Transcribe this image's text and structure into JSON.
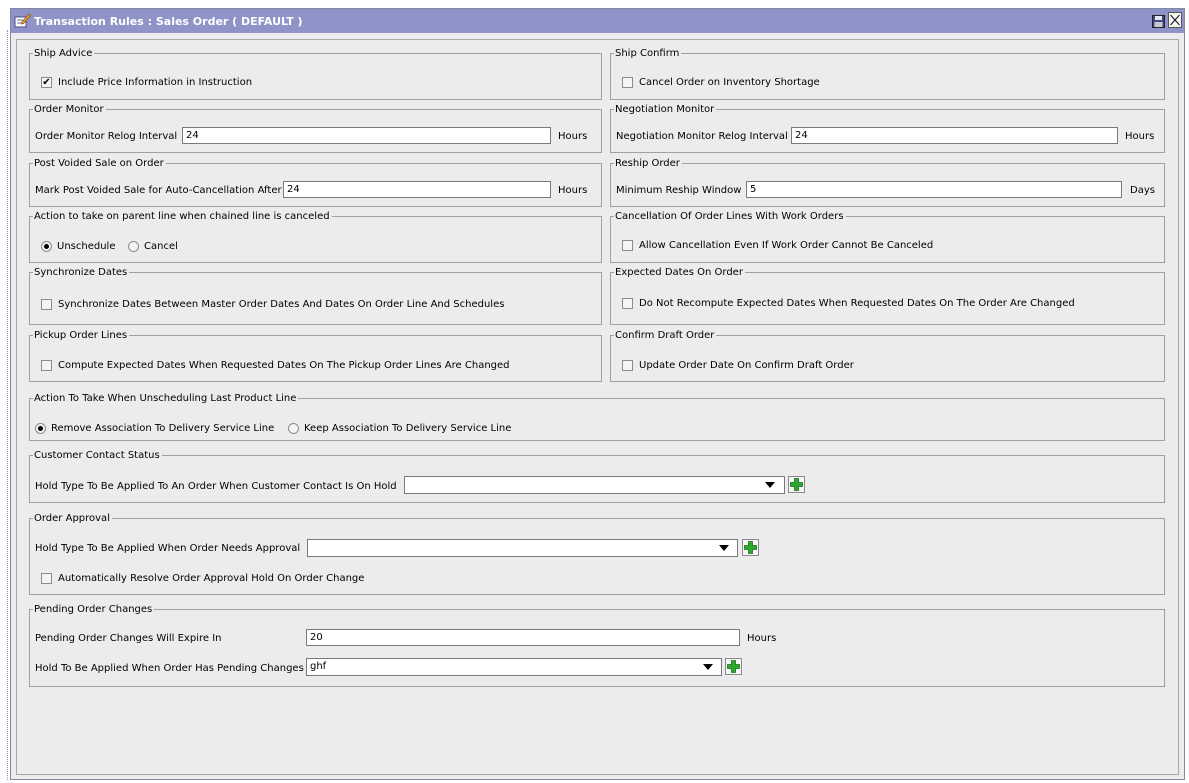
{
  "window": {
    "title": "Transaction Rules : Sales Order ( DEFAULT )",
    "title_icon": "edit-document-icon",
    "save_icon": "save-icon",
    "close_icon": "close-icon"
  },
  "colors": {
    "titlebar": "#8f93c8",
    "panel": "#ececec",
    "add_button": "#2fa82f"
  },
  "ship_advice": {
    "title": "Ship Advice",
    "include_price_label": "Include Price Information in Instruction",
    "include_price_checked": true
  },
  "ship_confirm": {
    "title": "Ship Confirm",
    "cancel_shortage_label": "Cancel Order on Inventory Shortage",
    "cancel_shortage_checked": false
  },
  "order_monitor": {
    "title": "Order Monitor",
    "relog_label": "Order Monitor Relog Interval",
    "relog_value": "24",
    "unit": "Hours"
  },
  "negotiation_monitor": {
    "title": "Negotiation Monitor",
    "relog_label": "Negotiation Monitor Relog Interval",
    "relog_value": "24",
    "unit": "Hours"
  },
  "post_voided": {
    "title": "Post Voided Sale on Order",
    "mark_label": "Mark Post Voided Sale for Auto-Cancellation After",
    "mark_value": "24",
    "unit": "Hours"
  },
  "reship": {
    "title": "Reship Order",
    "window_label": "Minimum Reship Window",
    "window_value": "5",
    "unit": "Days"
  },
  "parent_line_action": {
    "title": "Action to take on parent line when chained line is canceled",
    "unschedule_label": "Unschedule",
    "cancel_label": "Cancel",
    "selected": "Unschedule"
  },
  "cancellation_work_orders": {
    "title": "Cancellation Of Order Lines With Work Orders",
    "allow_label": "Allow Cancellation Even If Work Order Cannot Be Canceled",
    "allow_checked": false
  },
  "synchronize_dates": {
    "title": "Synchronize Dates",
    "sync_label": "Synchronize Dates Between Master Order Dates And Dates On Order Line And Schedules",
    "sync_checked": false
  },
  "expected_dates": {
    "title": "Expected Dates On Order",
    "no_recompute_label": "Do Not Recompute Expected Dates When Requested Dates On The Order Are Changed",
    "no_recompute_checked": false
  },
  "pickup_lines": {
    "title": "Pickup Order Lines",
    "compute_label": "Compute Expected Dates When Requested Dates On The Pickup Order Lines Are Changed",
    "compute_checked": false
  },
  "confirm_draft": {
    "title": "Confirm Draft Order",
    "update_label": "Update Order Date On Confirm Draft Order",
    "update_checked": false
  },
  "unscheduling_last_line": {
    "title": "Action To Take When Unscheduling Last Product Line",
    "remove_label": "Remove Association To Delivery Service Line",
    "keep_label": "Keep Association To Delivery Service Line",
    "selected": "Remove Association To Delivery Service Line"
  },
  "customer_contact": {
    "title": "Customer Contact Status",
    "hold_label": "Hold Type To Be Applied To An Order When Customer Contact Is On Hold",
    "hold_value": ""
  },
  "order_approval": {
    "title": "Order Approval",
    "hold_label": "Hold Type To Be Applied When Order Needs Approval",
    "hold_value": "",
    "auto_resolve_label": "Automatically Resolve Order Approval Hold On Order Change",
    "auto_resolve_checked": false
  },
  "pending_changes": {
    "title": "Pending Order Changes",
    "expire_label": "Pending Order Changes Will Expire In",
    "expire_value": "20",
    "unit": "Hours",
    "hold_label": "Hold To Be Applied When Order Has Pending Changes",
    "hold_value": "ghf"
  }
}
